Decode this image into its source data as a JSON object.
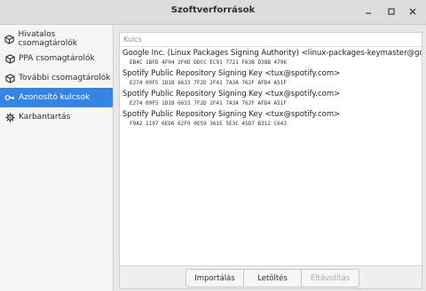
{
  "window": {
    "title": "Szoftverforrások"
  },
  "sidebar": {
    "items": [
      {
        "label": "Hivatalos csomagtárolók",
        "icon": "package-icon",
        "active": false
      },
      {
        "label": "PPA csomagtárolók",
        "icon": "package-icon",
        "active": false
      },
      {
        "label": "További csomagtárolók",
        "icon": "package-icon",
        "active": false
      },
      {
        "label": "Azonosító kulcsok",
        "icon": "key-icon",
        "active": true
      },
      {
        "label": "Karbantartás",
        "icon": "gear-icon",
        "active": false
      }
    ]
  },
  "keys": {
    "column_header": "Kulcs",
    "entries": [
      {
        "name": "Google Inc. (Linux Packages Signing Authority) <linux-packages-keymaster@google.com>",
        "fingerprint": "EB4C 1BFD 4F04 2F6D DDCC  EC91 7721 F63B D38B 4796"
      },
      {
        "name": "Spotify Public Repository Signing Key <tux@spotify.com>",
        "fingerprint": "E274 09F5 1D1B 6633 7F2D  2F41 7A3A 762F AFD4 A51F"
      },
      {
        "name": "Spotify Public Repository Signing Key <tux@spotify.com>",
        "fingerprint": "E274 09F5 1D1B 6633 7F2D  2F41 7A3A 762F AFD4 A51F"
      },
      {
        "name": "Spotify Public Repository Signing Key <tux@spotify.com>",
        "fingerprint": "F9A2 1197 6ED6 62F0 0E59  361E 5E3C 45D7 B312 C643"
      }
    ]
  },
  "buttons": {
    "import": "Importálás",
    "download": "Letöltés",
    "remove": "Eltávolítás"
  },
  "colors": {
    "accent": "#3584e4"
  }
}
